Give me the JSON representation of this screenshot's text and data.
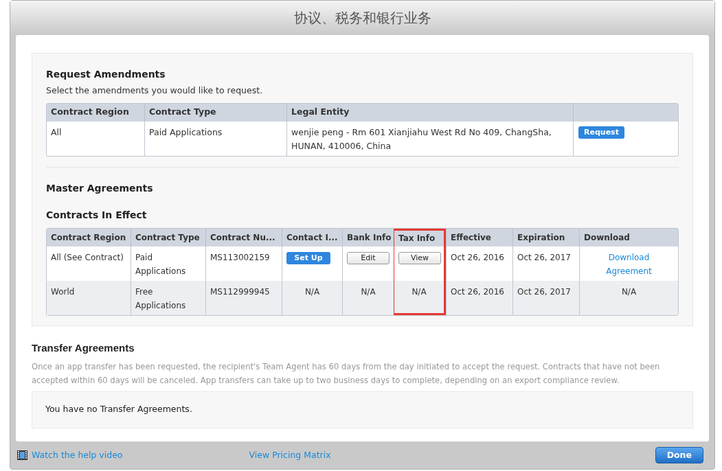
{
  "window": {
    "title": "协议、税务和银行业务"
  },
  "request_amendments": {
    "heading": "Request Amendments",
    "subtitle": "Select the amendments you would like to request.",
    "columns": [
      "Contract Region",
      "Contract Type",
      "Legal Entity",
      ""
    ],
    "rows": [
      {
        "cells": [
          "All",
          "Paid Applications",
          "wenjie peng - Rm 601 Xianjiahu West Rd No 409, ChangSha, HUNAN, 410006, China"
        ],
        "button": "Request"
      }
    ]
  },
  "master_agreements": {
    "heading": "Master Agreements"
  },
  "contracts_in_effect": {
    "heading": "Contracts In Effect",
    "columns": [
      {
        "label": "Contract Region",
        "highlighted": false
      },
      {
        "label": "Contract Type",
        "highlighted": false
      },
      {
        "label": "Contract Nu...",
        "highlighted": false
      },
      {
        "label": "Contact I...",
        "highlighted": false
      },
      {
        "label": "Bank Info",
        "highlighted": false
      },
      {
        "label": "Tax Info",
        "highlighted": true
      },
      {
        "label": "Effective",
        "highlighted": false
      },
      {
        "label": "Expiration",
        "highlighted": false
      },
      {
        "label": "Download",
        "highlighted": false
      }
    ],
    "rows": [
      {
        "cells": [
          {
            "kind": "text",
            "text": "All (See Contract)"
          },
          {
            "kind": "text",
            "text": "Paid Applications"
          },
          {
            "kind": "text",
            "text": "MS113002159"
          },
          {
            "kind": "primary_button",
            "text": "Set Up"
          },
          {
            "kind": "button",
            "text": "Edit"
          },
          {
            "kind": "button",
            "text": "View"
          },
          {
            "kind": "text",
            "text": "Oct 26, 2016"
          },
          {
            "kind": "text",
            "text": "Oct 26, 2017"
          },
          {
            "kind": "link",
            "text": "Download Agreement"
          }
        ]
      },
      {
        "cells": [
          {
            "kind": "text",
            "text": "World"
          },
          {
            "kind": "text",
            "text": "Free Applications"
          },
          {
            "kind": "text",
            "text": "MS112999945"
          },
          {
            "kind": "center",
            "text": "N/A"
          },
          {
            "kind": "center",
            "text": "N/A"
          },
          {
            "kind": "center",
            "text": "N/A"
          },
          {
            "kind": "text",
            "text": "Oct 26, 2016"
          },
          {
            "kind": "text",
            "text": "Oct 26, 2017"
          },
          {
            "kind": "center",
            "text": "N/A"
          }
        ]
      }
    ]
  },
  "transfer_agreements": {
    "heading": "Transfer Agreements",
    "description": "Once an app transfer has been requested, the recipient's Team Agent has 60 days from the day initiated to accept the request. Contracts that have not been accepted within 60 days will be canceled. App transfers can take up to two business days to complete, depending on an export compliance review.",
    "empty_message": "You have no Transfer Agreements."
  },
  "footer": {
    "help_link": "Watch the help video",
    "pricing_link": "View Pricing Matrix",
    "done_button": "Done"
  }
}
